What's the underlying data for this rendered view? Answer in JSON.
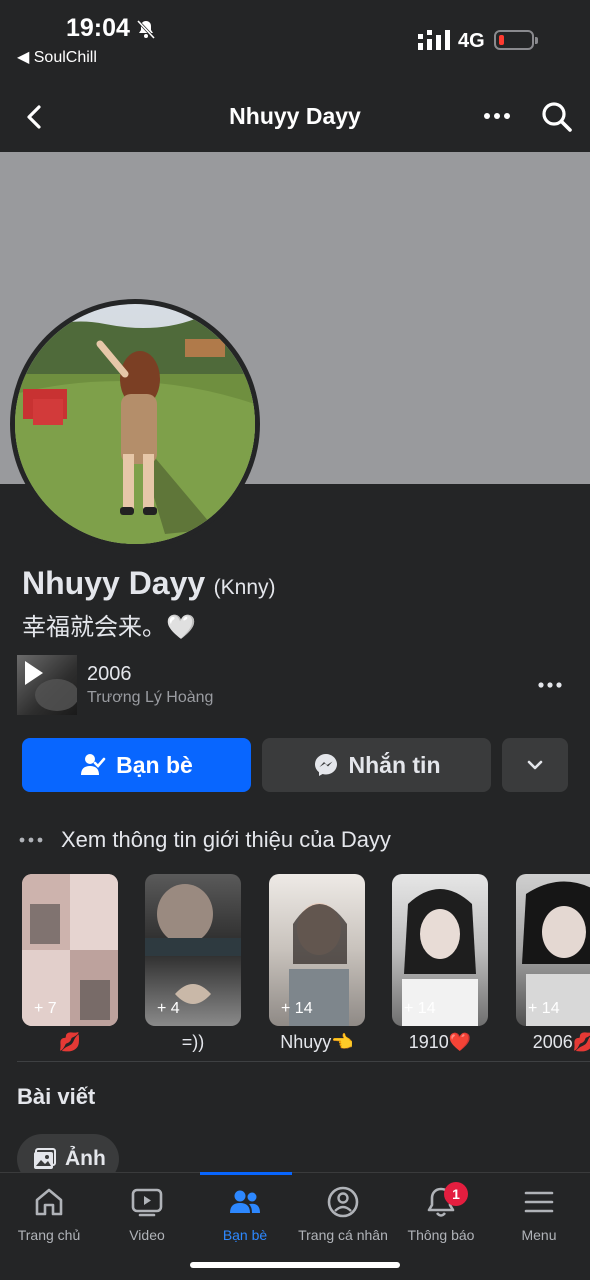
{
  "status_bar": {
    "time": "19:04",
    "back_app": "◀ SoulChill",
    "network": "4G"
  },
  "header": {
    "title": "Nhuyy Dayy"
  },
  "profile": {
    "name": "Nhuyy Dayy",
    "alternate_name": "(Knny)",
    "bio": "幸福就会来。🤍"
  },
  "music": {
    "title": "2006",
    "artist": "Trương Lý Hoàng"
  },
  "actions": {
    "friends_label": "Bạn bè",
    "message_label": "Nhắn tin"
  },
  "intro": {
    "label": "Xem thông tin giới thiệu của Dayy"
  },
  "highlights": [
    {
      "count": "+ 7",
      "label": "💋"
    },
    {
      "count": "+ 4",
      "label": "=))"
    },
    {
      "count": "+ 14",
      "label": "Nhuyy👈"
    },
    {
      "count": "+ 14",
      "label": "1910❤️"
    },
    {
      "count": "+ 14",
      "label": "2006💋"
    }
  ],
  "posts": {
    "title": "Bài viết",
    "photos_chip": "Ảnh"
  },
  "tabbar": {
    "home": "Trang chủ",
    "video": "Video",
    "friends": "Bạn bè",
    "profile": "Trang cá nhân",
    "notifications": "Thông báo",
    "notifications_badge": "1",
    "menu": "Menu"
  },
  "colors": {
    "accent": "#0866ff",
    "background": "#242526",
    "badge": "#e41e3f"
  }
}
